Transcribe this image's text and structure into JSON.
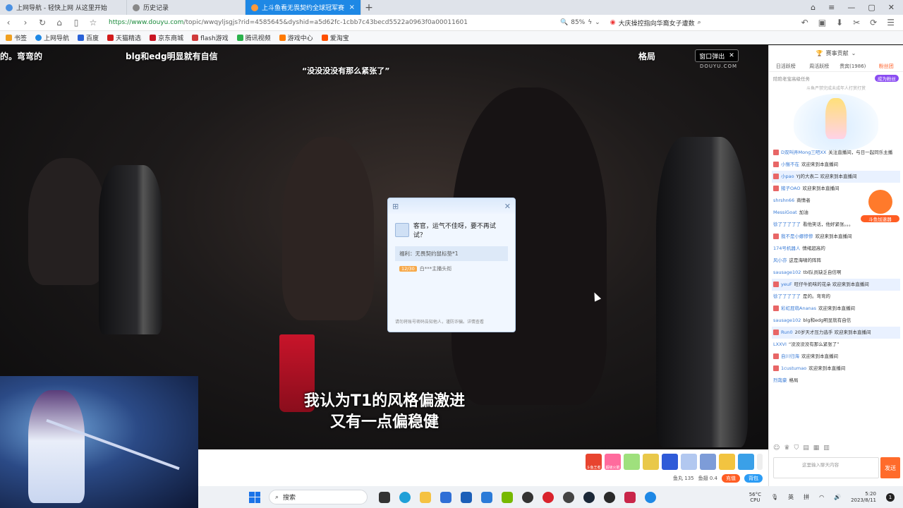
{
  "browser": {
    "tabs": [
      {
        "label": "上网导航 - 轻快上网 从这里开始"
      },
      {
        "label": "历史记录"
      },
      {
        "label": "上斗鱼看无畏契约全球冠军赛",
        "active": true
      }
    ],
    "url_domain": "https://www.douyu.com",
    "url_path": "/topic/wwqyljsgjs?rid=4585645&dyshid=a5d62fc-1cbb7c43becd5522a0963f0a00011601",
    "zoom": "85%",
    "search_text": "大庆操控指向华裔女子遭数",
    "bookmarks": [
      "书签",
      "上网导航",
      "百度",
      "天猫精选",
      "京东商城",
      "flash游戏",
      "腾讯视频",
      "游戏中心",
      "爱淘宝"
    ]
  },
  "video": {
    "top_captions": [
      "的。弯弯的",
      "blg和edg明显就有自信",
      "格局"
    ],
    "center_caption": "“没没没没有那么紧张了”",
    "popout_label": "窗口弹出",
    "watermark": "DOUYU.COM",
    "subtitle_line1": "我认为T1的风格偏激进",
    "subtitle_line2": "又有一点偏稳健"
  },
  "dialog": {
    "message": "客官，运气不佳呀，要不再试试？",
    "reward": "福利：无畏契约鼠标垫*1",
    "level": "12/30",
    "user": "白***主播头衔",
    "note": "请勿将账号密码告知他人，谨防诈骗。详情查看"
  },
  "under_video": {
    "gifts": [
      "斗鱼王者",
      "超级火箭",
      "",
      "",
      "",
      "",
      "",
      "",
      "",
      ""
    ],
    "stat_fish": "鱼丸 135",
    "stat_fins": "鱼翅 0.4",
    "recharge": "充值",
    "backpack": "背包"
  },
  "sidebar": {
    "rank_title": "赛事贡献",
    "tabs": [
      "日活跃榜",
      "周活跃榜",
      "贵宾(1986)",
      "粉丝团"
    ],
    "fans_text": "陪陪老宝高级任务",
    "fans_button": "成为粉丝",
    "sub_text": "斗鱼严禁完成未成年人打赏打赏",
    "accel_label": "斗鱼加速器",
    "chat": [
      {
        "name": "D双叫弄Mong三吧XX",
        "text": "关注直播间，与日一起同乐主播"
      },
      {
        "name": "小猴不在",
        "text": "欢迎来到本直播间"
      },
      {
        "name": "小pao",
        "text": "YJ的大表二 欢迎来到本直播间",
        "hl": true
      },
      {
        "name": "猪子OAO",
        "text": "欢迎来到本直播间"
      },
      {
        "name": "shrshn66",
        "text": "商情者"
      },
      {
        "name": "MessiGoat",
        "text": "加油"
      },
      {
        "name": "徐了了了了了",
        "text": "看他笑话，他好紧张。。。"
      },
      {
        "name": "我不是小娜惨惨",
        "text": "欢迎来到本直播间"
      },
      {
        "name": "174号机器人",
        "text": "情绪超高的"
      },
      {
        "name": "风小亦",
        "text": "这是海啸的阵阵"
      },
      {
        "name": "sausage102",
        "text": "tbl队员缺乏自信啊"
      },
      {
        "name": "yeuF",
        "text": "旺仔牛奶味的花朵 欢迎来到本直播间",
        "hl": true
      },
      {
        "name": "徐了了了了了",
        "text": "是的。弯弯的"
      },
      {
        "name": "彩虹屁萌Ananas",
        "text": "欢迎来到本直播间"
      },
      {
        "name": "sausage102",
        "text": "blg和edg明显就有自信"
      },
      {
        "name": "Run0",
        "text": "20岁天才压力选手 欢迎来到本直播间",
        "hl": true
      },
      {
        "name": "LXXVI",
        "text": "“没没没没有那么紧张了”"
      },
      {
        "name": "自川归海",
        "text": "欢迎来到本直播间"
      },
      {
        "name": "1custumao",
        "text": "欢迎来到本直播间"
      },
      {
        "name": "烈哉豪",
        "text": "格局"
      }
    ],
    "input_placeholder": "这里输入聊天内容",
    "send_label": "发送"
  },
  "taskbar": {
    "search_label": "搜索",
    "cpu_temp": "56°C",
    "cpu_label": "CPU",
    "ime_1": "英",
    "ime_2": "拼",
    "time": "5:20",
    "date": "2023/8/11"
  }
}
